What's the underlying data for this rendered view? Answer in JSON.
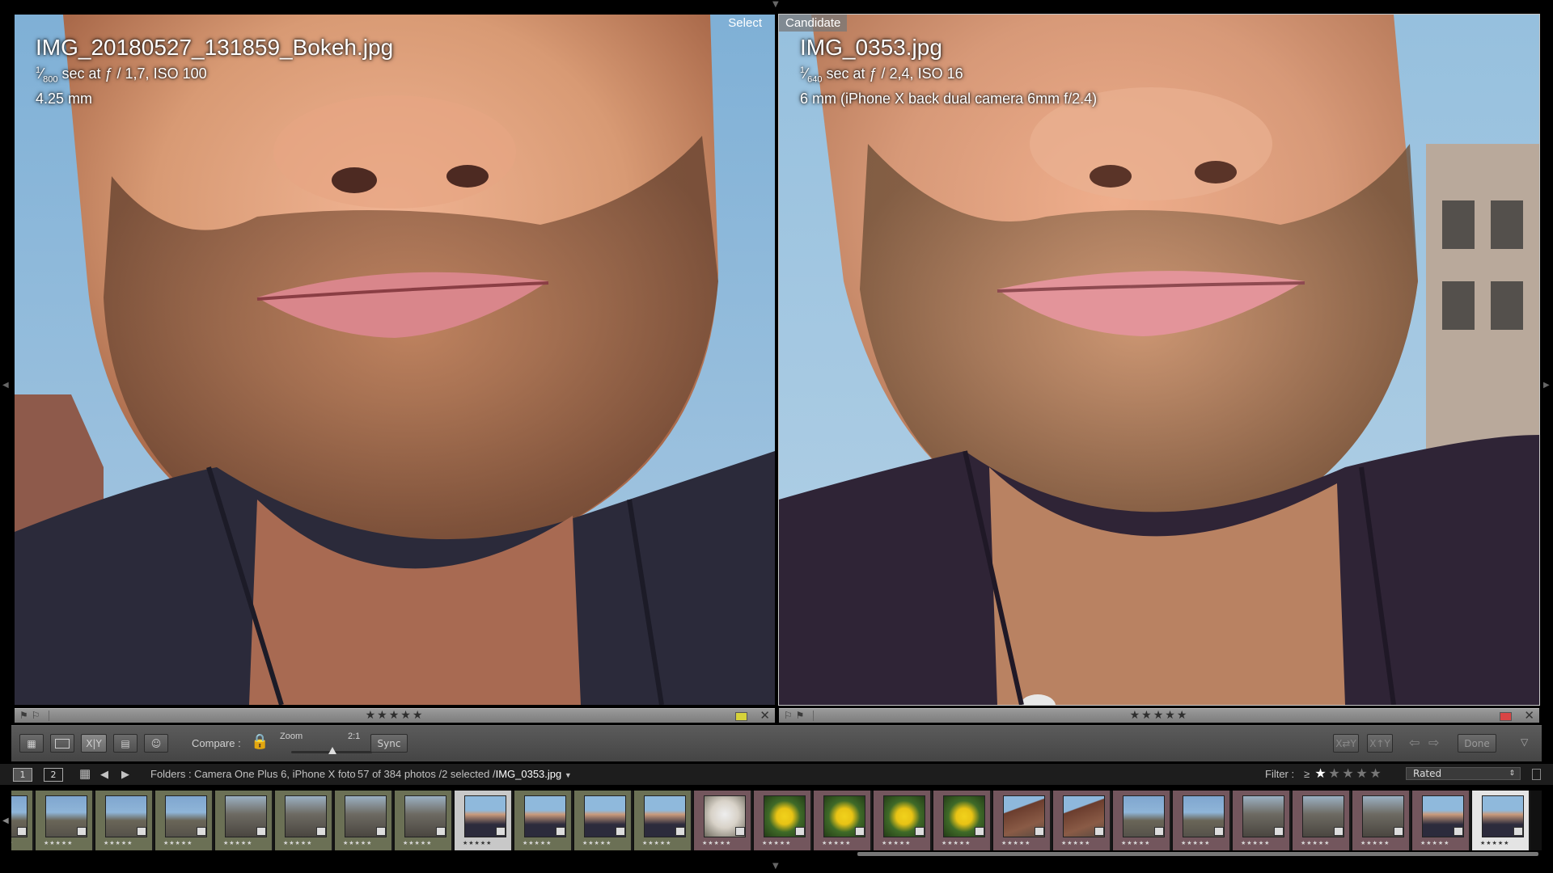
{
  "left_pane": {
    "tag": "Select",
    "filename": "IMG_20180527_131859_Bokeh.jpg",
    "exposure_num": "1",
    "exposure_den": "800",
    "exposure_rest": " sec at ƒ / 1,7, ISO 100",
    "focal": "4.25 mm"
  },
  "right_pane": {
    "tag": "Candidate",
    "filename": "IMG_0353.jpg",
    "exposure_num": "1",
    "exposure_den": "640",
    "exposure_rest": " sec at ƒ / 2,4, ISO 16",
    "focal": "6 mm (iPhone X back dual camera 6mm f/2.4)"
  },
  "strips": {
    "left": {
      "stars": "★★★★★",
      "label_color": "#d6d23a",
      "close": "✕"
    },
    "right": {
      "stars": "★★★★★",
      "label_color": "#d94545",
      "close": "✕"
    }
  },
  "toolbar": {
    "compare_label": "Compare :",
    "zoom_label": "Zoom",
    "zoom_value": "2:1",
    "sync_label": "Sync",
    "xy_label": "X|Y",
    "done_label": "Done"
  },
  "filmstrip_header": {
    "screen1": "1",
    "screen2": "2",
    "source": "Folders : Camera One Plus 6, iPhone X foto",
    "count": "57 of 384 photos /2 selected /",
    "current_file": "IMG_0353.jpg",
    "filter_label": "Filter :",
    "filter_op": "≥",
    "filter_value": "Rated"
  },
  "filmstrip": {
    "thumbs": [
      {
        "kind": "street",
        "label": "green",
        "mini": "★★★★★"
      },
      {
        "kind": "street",
        "label": "green",
        "mini": "★★★★★"
      },
      {
        "kind": "street",
        "label": "green",
        "mini": "★★★★★"
      },
      {
        "kind": "street",
        "label": "green",
        "mini": "★★★★★"
      },
      {
        "kind": "fountain",
        "label": "green",
        "mini": "★★★★★"
      },
      {
        "kind": "fountain",
        "label": "green",
        "mini": "★★★★★"
      },
      {
        "kind": "fountain",
        "label": "green",
        "mini": "★★★★★"
      },
      {
        "kind": "fountain",
        "label": "green",
        "mini": "★★★★★"
      },
      {
        "kind": "portrait",
        "label": "sel",
        "mini": "★★★★★"
      },
      {
        "kind": "portrait",
        "label": "green",
        "mini": "★★★★★"
      },
      {
        "kind": "portrait",
        "label": "green",
        "mini": "★★★★★"
      },
      {
        "kind": "portrait",
        "label": "green",
        "mini": "★★★★★"
      },
      {
        "kind": "dog",
        "label": "red",
        "mini": "★★★★★"
      },
      {
        "kind": "flower",
        "label": "red",
        "mini": "★★★★★"
      },
      {
        "kind": "flower",
        "label": "red",
        "mini": "★★★★★"
      },
      {
        "kind": "flower",
        "label": "red",
        "mini": "★★★★★"
      },
      {
        "kind": "flower",
        "label": "red",
        "mini": "★★★★★"
      },
      {
        "kind": "roof",
        "label": "red",
        "mini": "★★★★★"
      },
      {
        "kind": "roof",
        "label": "red",
        "mini": "★★★★★"
      },
      {
        "kind": "street",
        "label": "red",
        "mini": "★★★★★"
      },
      {
        "kind": "street",
        "label": "red",
        "mini": "★★★★★"
      },
      {
        "kind": "fountain",
        "label": "red",
        "mini": "★★★★★"
      },
      {
        "kind": "fountain",
        "label": "red",
        "mini": "★★★★★"
      },
      {
        "kind": "fountain",
        "label": "red",
        "mini": "★★★★★"
      },
      {
        "kind": "portrait",
        "label": "red",
        "mini": "★★★★★"
      },
      {
        "kind": "portrait",
        "label": "active",
        "mini": "★★★★★"
      }
    ]
  },
  "colors": {
    "sky": "#8db8d8",
    "skin": "#d9a07f",
    "shirt": "#2b2a3a",
    "label_green": "#6b7055",
    "label_red": "#73565d"
  }
}
